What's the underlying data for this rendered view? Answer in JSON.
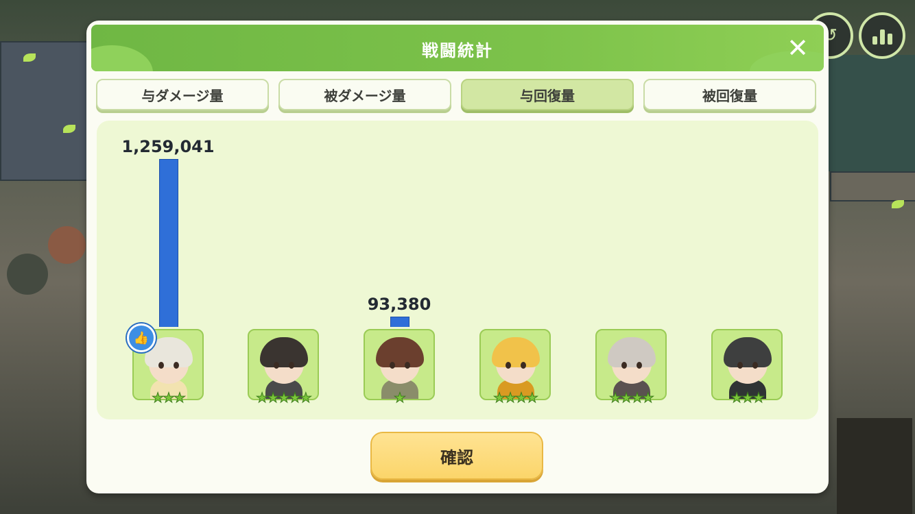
{
  "dialog": {
    "title": "戦闘統計",
    "close_label": "✕",
    "confirm_label": "確認"
  },
  "tabs": [
    {
      "label": "与ダメージ量",
      "active": false
    },
    {
      "label": "被ダメージ量",
      "active": false
    },
    {
      "label": "与回復量",
      "active": true
    },
    {
      "label": "被回復量",
      "active": false
    }
  ],
  "chart_data": {
    "type": "bar",
    "categories": [
      "character-1",
      "character-2",
      "character-3",
      "character-4",
      "character-5",
      "character-6"
    ],
    "values": [
      1259041,
      0,
      93380,
      0,
      0,
      0
    ],
    "value_labels": [
      "1,259,041",
      "",
      "93,380",
      "",
      "",
      ""
    ],
    "ylim": [
      0,
      1259041
    ],
    "bar_color": "#2f6fd8"
  },
  "characters": [
    {
      "stars": "★★★",
      "hair": "#e9e6dc",
      "outfit": "#f2e3b0",
      "badge": "👍"
    },
    {
      "stars": "★★★★★",
      "hair": "#3a3430",
      "outfit": "#4a4a4a",
      "badge": ""
    },
    {
      "stars": "★",
      "hair": "#6b3f2e",
      "outfit": "#8a8d6a",
      "badge": ""
    },
    {
      "stars": "★★★★",
      "hair": "#f1c24a",
      "outfit": "#d99a22",
      "badge": ""
    },
    {
      "stars": "★★★★",
      "hair": "#cfc9c2",
      "outfit": "#5a5150",
      "badge": ""
    },
    {
      "stars": "★★★",
      "hair": "#3e3f3f",
      "outfit": "#2f3434",
      "badge": ""
    }
  ],
  "colors": {
    "header": "#7cc24a",
    "panel": "#eef8d4",
    "active_tab": "#d2e7a3",
    "confirm": "#fbd56a"
  }
}
